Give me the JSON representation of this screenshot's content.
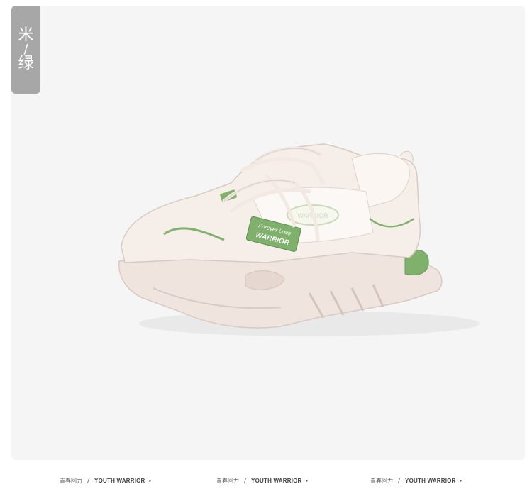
{
  "tag": {
    "line1": "米",
    "slash": "/",
    "line2": "绿"
  },
  "shoe": {
    "label_line1": "Forever Love",
    "label_line2": "WARRIOR",
    "logo_text": "WARRIOR",
    "colors": {
      "upper": "#f4ebe5",
      "sole": "#efe4de",
      "accent_green": "#7fb16d",
      "background": "#f5f5f5"
    }
  },
  "footer": {
    "items": [
      {
        "cn": "青春回力",
        "sep": "/",
        "en": "YOUTH WARRIOR",
        "arrow": "▸"
      },
      {
        "cn": "青春回力",
        "sep": "/",
        "en": "YOUTH WARRIOR",
        "arrow": "▸"
      },
      {
        "cn": "青春回力",
        "sep": "/",
        "en": "YOUTH WARRIOR",
        "arrow": "▸"
      }
    ]
  }
}
